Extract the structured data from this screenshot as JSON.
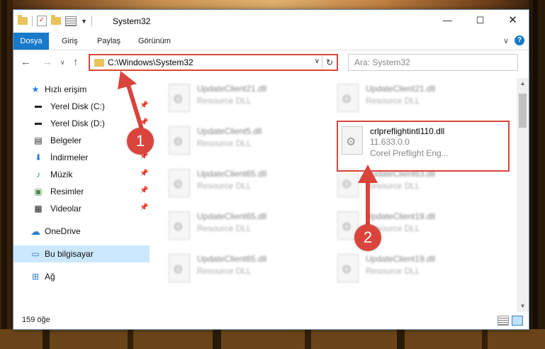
{
  "window": {
    "title": "System32",
    "controls": {
      "minimize": "—",
      "maximize": "☐",
      "close": "✕"
    }
  },
  "ribbon": {
    "tabs": [
      "Dosya",
      "Giriş",
      "Paylaş",
      "Görünüm"
    ]
  },
  "nav": {
    "address": "C:\\Windows\\System32",
    "search_placeholder": "Ara: System32"
  },
  "sidebar": {
    "items": [
      {
        "label": "Hızlı erişim",
        "icon": "star-icon",
        "pinned": false
      },
      {
        "label": "Yerel Disk (C:)",
        "icon": "drive-icon",
        "pinned": true
      },
      {
        "label": "Yerel Disk (D:)",
        "icon": "drive-icon",
        "pinned": true
      },
      {
        "label": "Belgeler",
        "icon": "documents-icon",
        "pinned": true
      },
      {
        "label": "İndirmeler",
        "icon": "download-icon",
        "pinned": true
      },
      {
        "label": "Müzik",
        "icon": "music-icon",
        "pinned": true
      },
      {
        "label": "Resimler",
        "icon": "pictures-icon",
        "pinned": true
      },
      {
        "label": "Videolar",
        "icon": "video-icon",
        "pinned": true
      },
      {
        "label": "OneDrive",
        "icon": "cloud-icon",
        "pinned": false
      },
      {
        "label": "Bu bilgisayar",
        "icon": "computer-icon",
        "pinned": false,
        "selected": true
      },
      {
        "label": "Ağ",
        "icon": "network-icon",
        "pinned": false
      }
    ]
  },
  "files": [
    {
      "name": "UpdateClient21.dll",
      "desc": "Resource DLL"
    },
    {
      "name": "UpdateClient21.dll",
      "desc": "Resource DLL"
    },
    {
      "name": "UpdateClient5.dll",
      "desc": "Resource DLL"
    },
    {
      "name": "crlpreflightintl110.dll",
      "version": "11.633.0.0",
      "desc": "Corel Preflight Eng..."
    },
    {
      "name": "UpdateClient65.dll",
      "desc": "Resource DLL"
    },
    {
      "name": "UpdateClient63.dll",
      "desc": "Resource DLL"
    },
    {
      "name": "UpdateClient65.dll",
      "desc": "Resource DLL"
    },
    {
      "name": "UpdateClient19.dll",
      "desc": "Resource DLL"
    },
    {
      "name": "UpdateClient65.dll",
      "desc": "Resource DLL"
    },
    {
      "name": "UpdateClient19.dll",
      "desc": "Resource DLL"
    }
  ],
  "status": {
    "count": "159 öğe"
  },
  "callouts": [
    "1",
    "2"
  ],
  "colors": {
    "accent": "#1979ca",
    "highlight": "#d9453c",
    "selected_bg": "#cce8ff"
  }
}
